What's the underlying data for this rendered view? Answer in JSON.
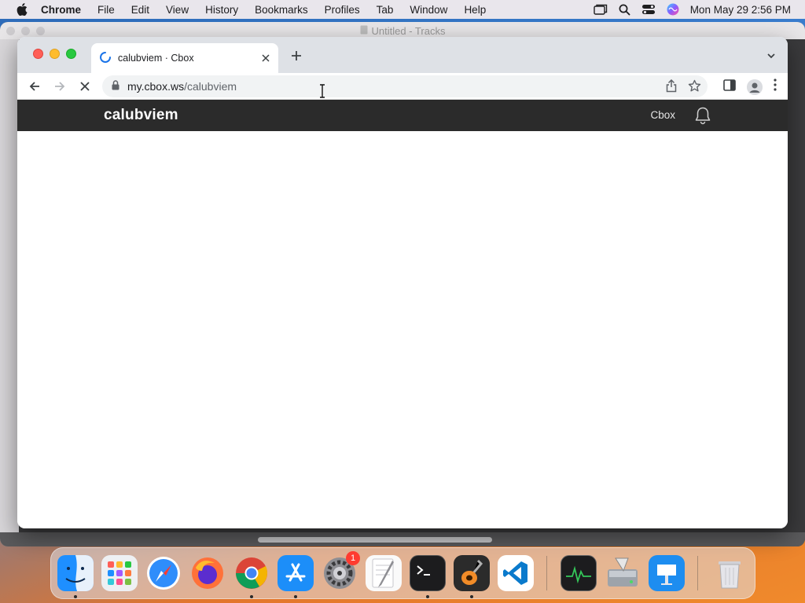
{
  "menubar": {
    "app_name": "Chrome",
    "items": [
      "File",
      "Edit",
      "View",
      "History",
      "Bookmarks",
      "Profiles",
      "Tab",
      "Window",
      "Help"
    ],
    "datetime": "Mon May 29  2:56 PM"
  },
  "background_window": {
    "title": "Untitled - Tracks"
  },
  "browser": {
    "tab_title": "calubviem · Cbox",
    "url_host": "my.cbox.ws",
    "url_path": "/calubviem"
  },
  "site": {
    "brand": "calubviem",
    "nav_link": "Cbox"
  },
  "dock": {
    "apps": [
      "finder-icon",
      "launchpad-icon",
      "safari-icon",
      "firefox-icon",
      "chrome-icon",
      "app-store-icon",
      "system-settings-icon",
      "textedit-icon",
      "terminal-icon",
      "garageband-icon",
      "vscode-icon",
      "activity-monitor-icon",
      "disk-utility-icon",
      "keynote-icon",
      "trash-icon"
    ],
    "settings_badge": "1"
  },
  "colors": {
    "site_header": "#2b2b2b",
    "tab_strip": "#dee1e6",
    "omnibox": "#f1f3f4"
  }
}
